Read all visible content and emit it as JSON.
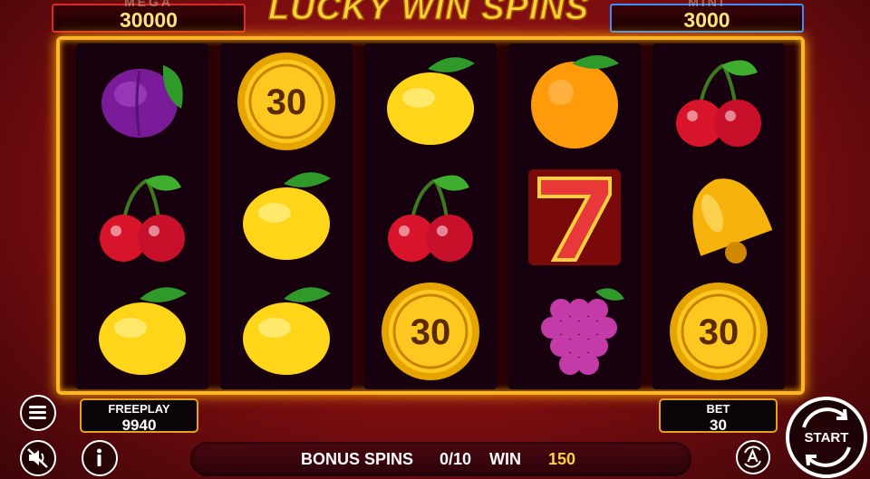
{
  "game": {
    "title": "LUCKY WIN SPINS"
  },
  "jackpots": {
    "mega": {
      "label": "MEGA",
      "value": "30000"
    },
    "mini": {
      "label": "MINI",
      "value": "3000"
    }
  },
  "reels": [
    [
      "plum-icon",
      "cherry-icon",
      "lemon-icon"
    ],
    [
      "coin-30-icon",
      "lemon-icon",
      "lemon-icon"
    ],
    [
      "lemon-icon",
      "cherry-icon",
      "coin-30-icon"
    ],
    [
      "orange-icon",
      "seven-icon",
      "grapes-icon"
    ],
    [
      "cherry-icon",
      "bell-icon",
      "coin-30-icon"
    ]
  ],
  "coin_value": "30",
  "freeplay": {
    "label": "FREEPLAY",
    "value": "9940"
  },
  "bet": {
    "label": "BET",
    "value": "30"
  },
  "bonus": {
    "label": "BONUS SPINS",
    "value": "0/10",
    "win_label": "WIN",
    "win_value": "150"
  },
  "start": {
    "label": "START"
  },
  "colors": {
    "frame": "#ffb52a",
    "mega_border": "#d92a2a",
    "mini_border": "#3f8cff",
    "win_value": "#ffd23a"
  }
}
